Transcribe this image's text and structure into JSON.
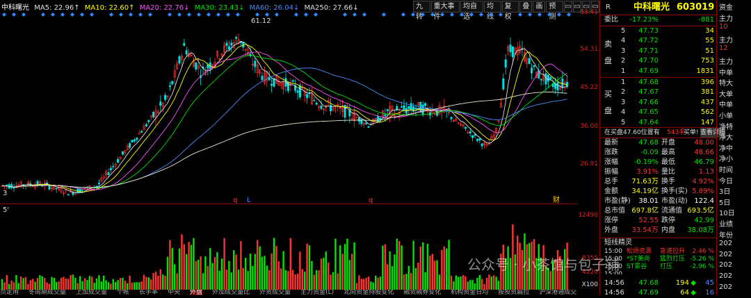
{
  "stock": {
    "name": "中科曙光",
    "code": "603019",
    "badge": "R"
  },
  "ma_bar": {
    "label": "中科曙光",
    "items": [
      {
        "text": "MA5: 22.96↑",
        "color": "#e0e0e0"
      },
      {
        "text": "MA10: 22.60↑",
        "color": "#ffff00"
      },
      {
        "text": "MA20: 22.76↓",
        "color": "#ff50ff"
      },
      {
        "text": "MA30: 23.43↓",
        "color": "#00e600"
      },
      {
        "text": "MA60: 26.04↓",
        "color": "#4a8cff"
      },
      {
        "text": "MA250: 27.66↓",
        "color": "#e0e0e0"
      }
    ]
  },
  "toolbar": {
    "items": [
      "九转",
      "重大事件",
      "均自选",
      "均线",
      "复权",
      "叠",
      "画",
      "预测"
    ],
    "ctl": [
      "▭",
      "▭",
      "▭",
      "▭"
    ]
  },
  "price_axis": [
    "63.41",
    "54.31",
    "45.22",
    "36.00",
    "26.91"
  ],
  "vol_axis": [
    "12490",
    "8355",
    "4220",
    "X100"
  ],
  "chart_annotations": {
    "high_label": "61.12",
    "left_low_mark": "3",
    "vol_label": "5'"
  },
  "markers": [
    "q",
    "L",
    "q",
    "q",
    "财"
  ],
  "bottom_tabs": [
    "页定用",
    "冬周期成交量",
    "上加成交量",
    "个帐",
    "长手率",
    "中央",
    "外盘",
    "外加成交量比",
    "外资成交量",
    "主力资金(L)",
    "北向资金持股变化",
    "融资融券变化",
    "机构资金日均",
    "按投资扁拉",
    "沪深港通成交"
  ],
  "active_tab": 6,
  "side": {
    "weibi": {
      "label": "委比",
      "value": "-17.23%",
      "diff": "-881"
    },
    "sell": [
      {
        "label": "5",
        "price": "47.73",
        "vol": "34"
      },
      {
        "label": "4",
        "price": "47.72",
        "vol": "55"
      },
      {
        "label": "3",
        "price": "47.71",
        "vol": "51"
      },
      {
        "label": "2",
        "price": "47.70",
        "vol": "753"
      },
      {
        "label": "1",
        "price": "47.69",
        "vol": "1831"
      }
    ],
    "buy": [
      {
        "label": "1",
        "price": "47.68",
        "vol": "396"
      },
      {
        "label": "2",
        "price": "47.67",
        "vol": "381"
      },
      {
        "label": "3",
        "price": "47.66",
        "vol": "437"
      },
      {
        "label": "4",
        "price": "47.65",
        "vol": "562"
      },
      {
        "label": "5",
        "price": "47.64",
        "vol": "147"
      }
    ],
    "sell_side_label": "卖\n盘",
    "buy_side_label": "买\n盘",
    "pending": {
      "prefix": "在买盘47.60位置有",
      "amount": "543手",
      "action": "买单!",
      "link": "查看详细"
    },
    "stats": [
      {
        "l1": "最新",
        "v1": "47.68",
        "c1": "green",
        "l2": "开盘",
        "v2": "48.00",
        "c2": "red"
      },
      {
        "l1": "涨跌",
        "v1": "-0.09",
        "c1": "green",
        "l2": "最高",
        "v2": "48.66",
        "c2": "red"
      },
      {
        "l1": "涨幅",
        "v1": "-0.19%",
        "c1": "green",
        "l2": "最低",
        "v2": "46.79",
        "c2": "green"
      },
      {
        "l1": "振幅",
        "v1": "3.91%",
        "c1": "red",
        "l2": "量比",
        "v2": "1.13",
        "c2": "red"
      },
      {
        "l1": "总手",
        "v1": "71.63万",
        "c1": "yellow",
        "l2": "换手",
        "v2": "4.92%",
        "c2": "red"
      },
      {
        "l1": "金额",
        "v1": "34.19亿",
        "c1": "yellow",
        "l2": "换手(实)",
        "v2": "5.89%",
        "c2": "red"
      },
      {
        "l1": "市盈(静)",
        "v1": "38.01",
        "c1": "white",
        "l2": "市盈(动)",
        "v2": "122.4",
        "c2": "white"
      },
      {
        "l1": "总市值",
        "v1": "697.8亿",
        "c1": "yellow",
        "l2": "流通值",
        "v2": "693.5亿",
        "c2": "yellow"
      },
      {
        "l1": "涨停",
        "v1": "52.55",
        "c1": "red",
        "l2": "跌停",
        "v2": "42.99",
        "c2": "green"
      },
      {
        "l1": "外盘",
        "v1": "33.54万",
        "c1": "red",
        "l2": "内盘",
        "v2": "38.08万",
        "c2": "green"
      }
    ],
    "short_title": "短线精灵",
    "short_items": [
      {
        "time": "15:00",
        "name": "松炀资源",
        "event": "急速拉升",
        "val": "2.46 %",
        "c": "red"
      },
      {
        "time": "15:00",
        "name": "*ST美尚",
        "event": "猛烈打压",
        "val": "-5.26 %",
        "c": "green"
      },
      {
        "time": "15:00",
        "name": "ST景谷",
        "event": "打压",
        "val": "-2.96 %",
        "c": "green"
      },
      {
        "time": "15:00",
        "name": "...",
        "event": "...",
        "val": "...",
        "c": "white"
      }
    ],
    "ticks": [
      {
        "time": "14:56",
        "price": "47.68",
        "vol": "194",
        "arrow": "◆",
        "cnt": "45",
        "c": "green"
      },
      {
        "time": "14:56",
        "price": "47.69",
        "vol": "64",
        "arrow": "◆",
        "cnt": "16",
        "c": "green"
      }
    ]
  },
  "far_right": [
    "资金",
    "主力",
    "10",
    "主力",
    "12",
    "主力",
    "中单",
    "特大",
    "大单",
    "中单",
    "小单",
    "净特",
    "净大",
    "净中",
    "净小",
    "时间",
    "今日",
    "3日",
    "5日",
    "10日",
    "业绩",
    "年份",
    "202",
    "202",
    "202",
    "202",
    "202"
  ],
  "watermark": "公众号 · 小茶馆与包子铺",
  "colors": {
    "up": "#ff3232",
    "down": "#00e600",
    "bg": "#000000",
    "grid": "#800000"
  }
}
